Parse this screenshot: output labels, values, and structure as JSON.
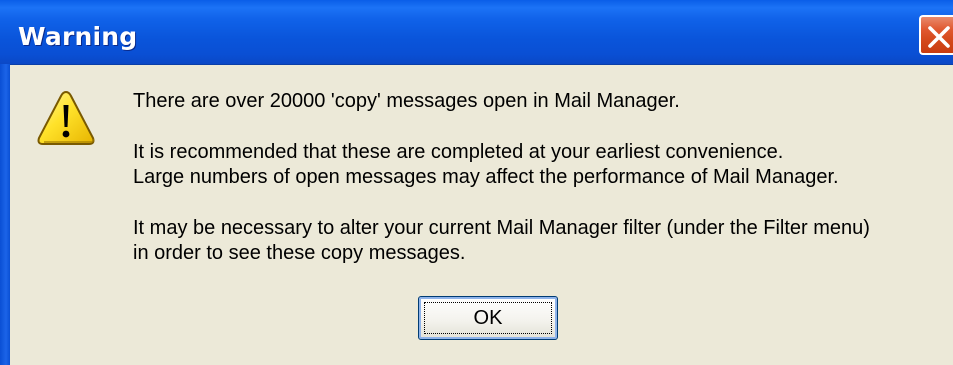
{
  "window": {
    "title": "Warning",
    "title_color": "#ffffff",
    "titlebar_color": "#0a55db",
    "body_color": "#ece9d8"
  },
  "icon": "warning-triangle-icon",
  "message": {
    "line1": "There are over 20000 'copy' messages open in Mail Manager.",
    "line2": "It is recommended that these are completed at your earliest convenience.",
    "line3": "Large numbers of open messages may affect the performance of Mail Manager.",
    "line4": "It may be necessary to alter your current Mail Manager filter (under the Filter menu)",
    "line5": "in order to see these copy messages."
  },
  "buttons": {
    "ok_label": "OK"
  }
}
